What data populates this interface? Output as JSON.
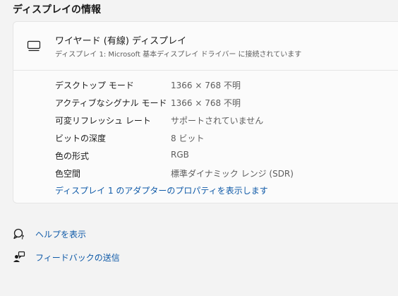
{
  "section": {
    "title": "ディスプレイの情報"
  },
  "display": {
    "name": "ワイヤード (有線) ディスプレイ",
    "subtitle": "ディスプレイ 1: Microsoft 基本ディスプレイ ドライバー に接続されています"
  },
  "properties": [
    {
      "label": "デスクトップ モード",
      "value": "1366 × 768 不明"
    },
    {
      "label": "アクティブなシグナル モード",
      "value": "1366 × 768 不明"
    },
    {
      "label": "可変リフレッシュ レート",
      "value": "サポートされていません"
    },
    {
      "label": "ビットの深度",
      "value": "8 ビット"
    },
    {
      "label": "色の形式",
      "value": "RGB"
    },
    {
      "label": "色空間",
      "value": "標準ダイナミック レンジ (SDR)"
    }
  ],
  "adapter_link": "ディスプレイ 1 のアダプターのプロパティを表示します",
  "help": {
    "show_help": "ヘルプを表示",
    "send_feedback": "フィードバックの送信"
  },
  "colors": {
    "link": "#0f5aa8",
    "card_bg": "#fbfbfb",
    "page_bg": "#f3f3f3"
  }
}
